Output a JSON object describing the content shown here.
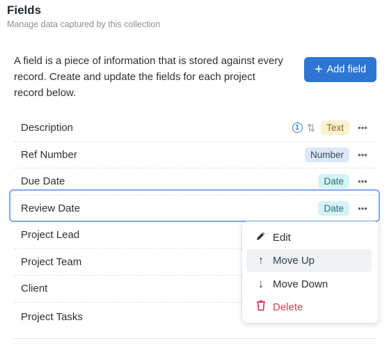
{
  "header": {
    "title": "Fields",
    "subtitle": "Manage data captured by this collection"
  },
  "intro": "A field is a piece of information that is stored against every record. Create and update the fields for each project record below.",
  "toolbar": {
    "add_field_label": "Add field",
    "add_field_icon": "plus-icon"
  },
  "fields": [
    {
      "name": "Description",
      "type": "Text",
      "info_count": "1",
      "has_sort": true
    },
    {
      "name": "Ref Number",
      "type": "Number"
    },
    {
      "name": "Due Date",
      "type": "Date"
    },
    {
      "name": "Review Date",
      "type": "Date",
      "selected": true
    },
    {
      "name": "Project Lead"
    },
    {
      "name": "Project Team"
    },
    {
      "name": "Client"
    },
    {
      "name": "Project Tasks"
    }
  ],
  "more_icon": "•••",
  "context_menu": {
    "items": [
      {
        "label": "Edit",
        "icon": "pencil-icon"
      },
      {
        "label": "Move Up",
        "icon": "arrow-up-icon",
        "hovered": true
      },
      {
        "label": "Move Down",
        "icon": "arrow-down-icon"
      },
      {
        "label": "Delete",
        "icon": "trash-icon",
        "danger": true
      }
    ]
  },
  "colors": {
    "accent": "#2f76d2",
    "danger": "#d93b4f",
    "selection_outline": "#7aa9ec"
  }
}
